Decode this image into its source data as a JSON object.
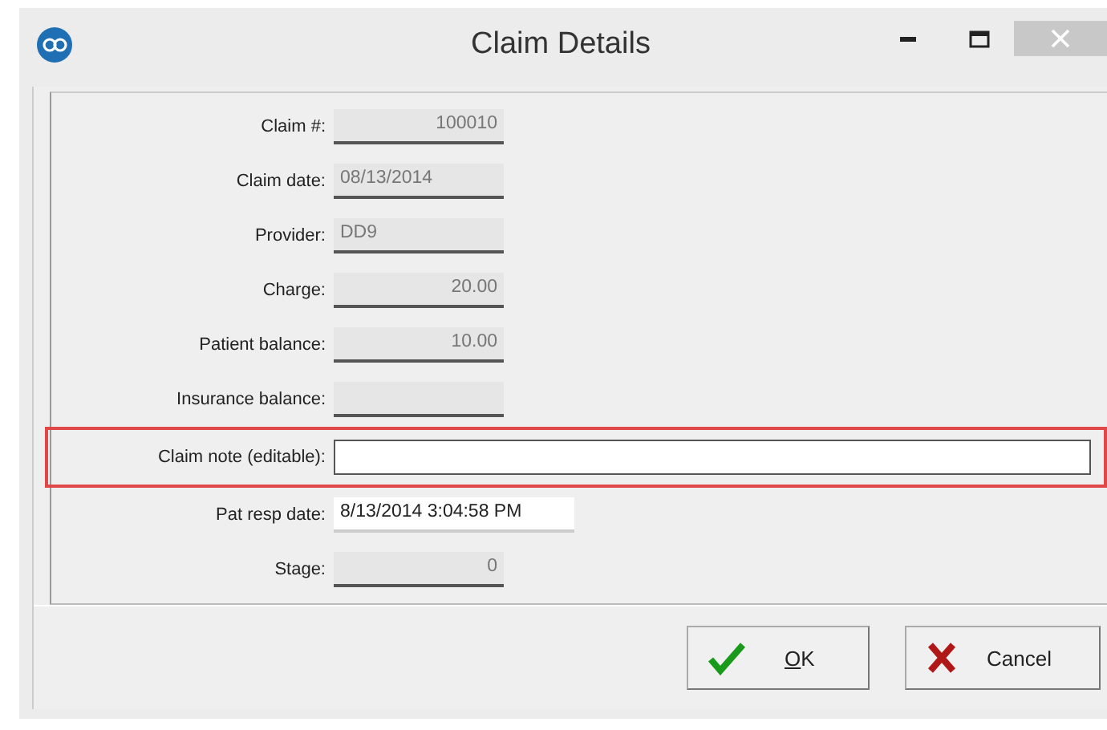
{
  "window": {
    "title": "Claim Details",
    "controls": [
      {
        "kind": "minimize"
      },
      {
        "kind": "maximize"
      },
      {
        "kind": "close"
      }
    ]
  },
  "fields": [
    {
      "label": "Claim #:",
      "value": "100010",
      "kind": "number",
      "highlighted": false
    },
    {
      "label": "Claim date:",
      "value": "08/13/2014",
      "kind": "text",
      "highlighted": false
    },
    {
      "label": "Provider:",
      "value": "DD9",
      "kind": "text",
      "highlighted": false
    },
    {
      "label": "Charge:",
      "value": "20.00",
      "kind": "number",
      "highlighted": false
    },
    {
      "label": "Patient balance:",
      "value": "10.00",
      "kind": "number",
      "highlighted": false
    },
    {
      "label": "Insurance balance:",
      "kind": "number",
      "highlighted": false
    },
    {
      "label": "Claim note (editable):",
      "kind": "editable",
      "highlighted": true
    },
    {
      "label": "Pat resp date:",
      "value": "8/13/2014 3:04:58 PM",
      "kind": "plain",
      "highlighted": false
    },
    {
      "label": "Stage:",
      "value": "0",
      "kind": "number",
      "highlighted": false
    }
  ],
  "buttons": [
    {
      "label": "OK",
      "kind": "ok",
      "mnemonic": true
    },
    {
      "label": "Cancel",
      "kind": "cancel",
      "mnemonic": false
    }
  ]
}
